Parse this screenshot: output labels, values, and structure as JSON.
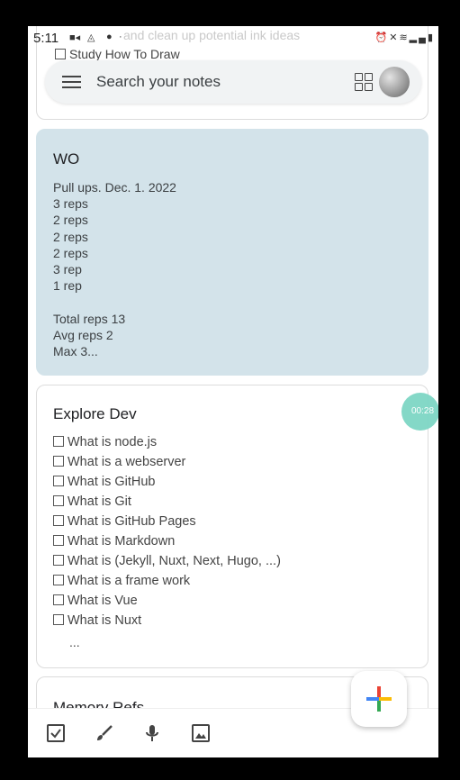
{
  "status_bar": {
    "time": "5:11",
    "ghost_text": "and clean up potential ink ideas"
  },
  "search": {
    "placeholder": "Search your notes"
  },
  "notes": {
    "top_fragment": "Study How To Draw",
    "wo": {
      "title": "WO",
      "lines": [
        "Pull ups. Dec. 1. 2022",
        "3 reps",
        "2 reps",
        "2 reps",
        "2 reps",
        "3 rep",
        "1 rep",
        "",
        "Total reps 13",
        "Avg reps 2",
        "Max 3..."
      ]
    },
    "explore": {
      "title": "Explore Dev",
      "items": [
        "What is node.js",
        "What is a webserver",
        "What is GitHub",
        "What is Git",
        "What is GitHub Pages",
        "What is Markdown",
        "What is (Jekyll, Nuxt, Next, Hugo, ...)",
        "What is a frame work",
        "What is Vue",
        "What is Nuxt"
      ],
      "more": "..."
    },
    "memory": {
      "title": "Memory Refs"
    }
  },
  "recording_badge": "00:28",
  "bottom_bar": {
    "icons": [
      "checkbox-icon",
      "brush-icon",
      "mic-icon",
      "image-icon"
    ]
  },
  "fab": {
    "icon": "plus-icon",
    "colors": [
      "#4285f4",
      "#ea4335",
      "#fbbc05",
      "#34a853"
    ]
  }
}
